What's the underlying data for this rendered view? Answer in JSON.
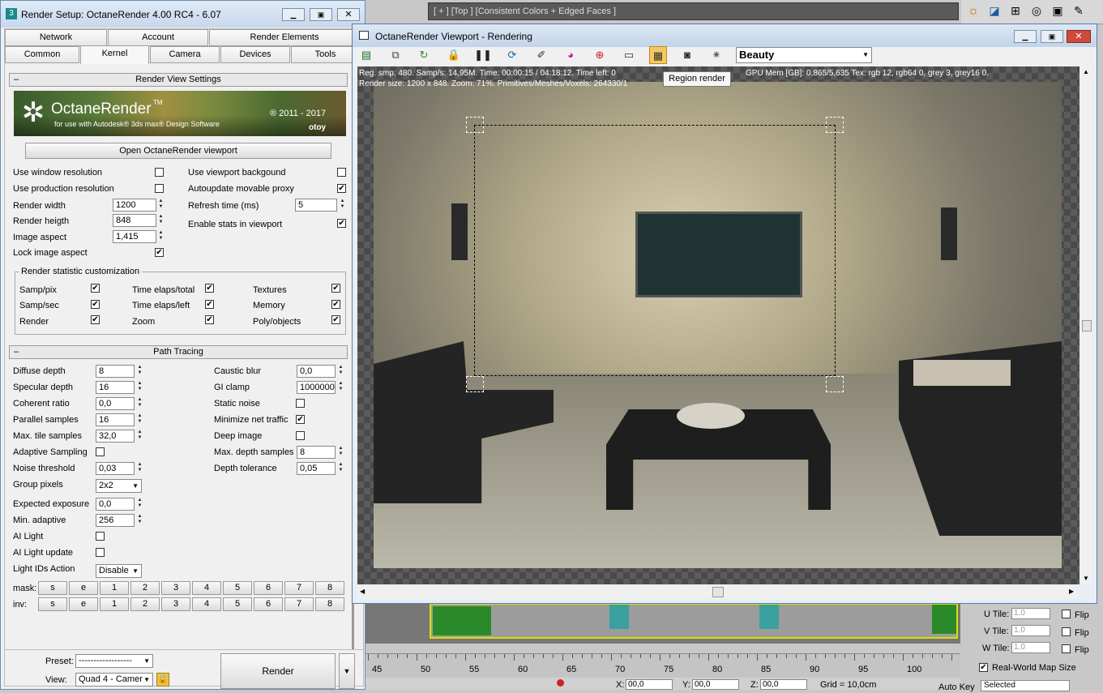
{
  "left_window": {
    "title": "Render Setup: OctaneRender 4.00 RC4 - 6.07",
    "tabs_row1": [
      "Network",
      "Account",
      "Render Elements"
    ],
    "tabs_row2": [
      "Common",
      "Kernel",
      "Camera",
      "Devices",
      "Tools"
    ],
    "rollout_render_view": "Render View Settings",
    "logo_name": "OctaneRender",
    "logo_tm": "TM",
    "logo_sub": "for use with Autodesk® 3ds max® Design Software",
    "logo_copyright": "® 2011 - 2017",
    "logo_brand": "otoy",
    "open_viewport": "Open OctaneRender viewport",
    "use_window_res": "Use window resolution",
    "use_production_res": "Use production resolution",
    "render_width": "Render width",
    "render_width_val": "1200",
    "render_height": "Render heigth",
    "render_height_val": "848",
    "image_aspect": "Image aspect",
    "image_aspect_val": "1,415",
    "lock_aspect": "Lock image aspect",
    "use_viewport_bg": "Use viewport backgound",
    "autoupdate_proxy": "Autoupdate movable proxy",
    "refresh_time": "Refresh time (ms)",
    "refresh_time_val": "5",
    "enable_stats": "Enable stats in viewport",
    "stat_group": "Render statistic customization",
    "stat_samp_pix": "Samp/pix",
    "stat_samp_sec": "Samp/sec",
    "stat_render": "Render",
    "stat_time_total": "Time elaps/total",
    "stat_time_left": "Time elaps/left",
    "stat_zoom": "Zoom",
    "stat_textures": "Textures",
    "stat_memory": "Memory",
    "stat_poly": "Poly/objects",
    "rollout_path": "Path Tracing",
    "diffuse_depth": "Diffuse depth",
    "diffuse_depth_val": "8",
    "specular_depth": "Specular depth",
    "specular_depth_val": "16",
    "coherent_ratio": "Coherent ratio",
    "coherent_ratio_val": "0,0",
    "parallel_samples": "Parallel samples",
    "parallel_samples_val": "16",
    "max_tile": "Max. tile samples",
    "max_tile_val": "32,0",
    "adaptive": "Adaptive Sampling",
    "noise_threshold": "Noise threshold",
    "noise_threshold_val": "0,03",
    "group_pixels": "Group pixels",
    "group_pixels_val": "2x2",
    "expected_exposure": "Expected exposure",
    "expected_exposure_val": "0,0",
    "min_adaptive": "Min. adaptive",
    "min_adaptive_val": "256",
    "ai_light": "AI Light",
    "ai_light_update": "AI Light update",
    "light_ids": "Light IDs Action",
    "light_ids_val": "Disable",
    "mask": "mask:",
    "inv": "inv:",
    "mask_buttons": [
      "s",
      "e",
      "1",
      "2",
      "3",
      "4",
      "5",
      "6",
      "7",
      "8"
    ],
    "caustic_blur": "Caustic blur",
    "caustic_blur_val": "0,0",
    "gi_clamp": "GI clamp",
    "gi_clamp_val": "1000000,",
    "static_noise": "Static noise",
    "min_net": "Minimize net traffic",
    "deep_image": "Deep image",
    "max_depth_samples": "Max. depth samples",
    "max_depth_samples_val": "8",
    "depth_tolerance": "Depth tolerance",
    "depth_tolerance_val": "0,05",
    "preset": "Preset:",
    "preset_val": "------------------",
    "view": "View:",
    "view_val": "Quad 4 - Camer",
    "render_btn": "Render"
  },
  "viewport_window": {
    "title": "OctaneRender Viewport - Rendering",
    "channel": "Beauty",
    "tooltip": "Region render",
    "stats_line1_a": "Reg. smp: 480.   Samp/s: 14,95M.   Time: 00:00:15 / 04:18:12.   Time left: 0",
    "stats_line1_b": "GPU Mem [GB]: 0,865/5,635   Tex: rgb 12, rgb64 0, grey 3, grey16 0.",
    "stats_line2": "Render size: 1200 x 848.   Zoom: 71%.   Primitives/Meshes/Voxels: 264330/1"
  },
  "max_ui": {
    "viewport_label": "[ + ] [Top ] [Consistent Colors + Edged Faces ]",
    "ruler": [
      "45",
      "50",
      "55",
      "60",
      "65",
      "70",
      "75",
      "80",
      "85",
      "90",
      "95",
      "100"
    ],
    "u_tile": "U Tile:",
    "v_tile": "V Tile:",
    "w_tile": "W Tile:",
    "tile_val": "1,0",
    "flip": "Flip",
    "real_world": "Real-World Map Size",
    "auto_key": "Auto Key",
    "selected": "Selected",
    "grid": "Grid = 10,0cm",
    "coord_x": "X:",
    "coord_y": "Y:",
    "coord_z": "Z:",
    "coord_val": "00,0"
  }
}
